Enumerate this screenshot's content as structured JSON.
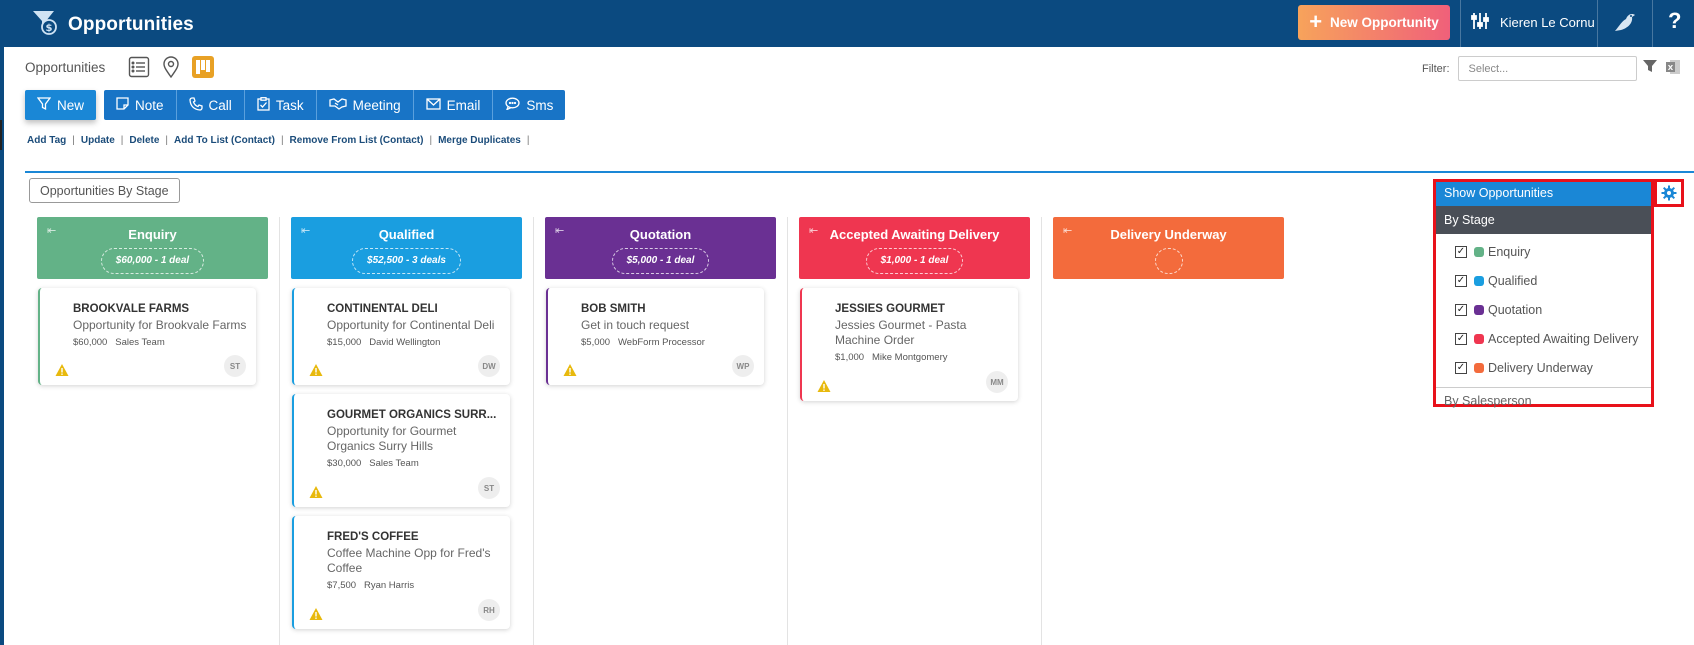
{
  "header": {
    "title": "Opportunities",
    "new_opportunity": "New Opportunity",
    "user_name": "Kieren Le Cornu",
    "help": "?"
  },
  "subheader": {
    "breadcrumb": "Opportunities",
    "filter_label": "Filter:",
    "filter_placeholder": "Select..."
  },
  "actions": {
    "new": "New",
    "note": "Note",
    "call": "Call",
    "task": "Task",
    "meeting": "Meeting",
    "email": "Email",
    "sms": "Sms"
  },
  "links": [
    "Add Tag",
    "Update",
    "Delete",
    "Add To List (Contact)",
    "Remove From List (Contact)",
    "Merge Duplicates"
  ],
  "view_label": "Opportunities By Stage",
  "colors": {
    "enquiry": "#63b287",
    "qualified": "#1a9ee0",
    "quotation": "#6a3093",
    "accepted": "#ef3650",
    "delivery": "#f36b3c"
  },
  "columns": [
    {
      "name": "Enquiry",
      "summary": "$60,000 - 1 deal",
      "cards": [
        {
          "name": "BROOKVALE FARMS",
          "desc": "Opportunity for Brookvale Farms",
          "amount": "$60,000",
          "owner": "Sales Team",
          "initials": "ST"
        }
      ]
    },
    {
      "name": "Qualified",
      "summary": "$52,500 - 3 deals",
      "cards": [
        {
          "name": "CONTINENTAL DELI",
          "desc": "Opportunity for Continental Deli",
          "amount": "$15,000",
          "owner": "David Wellington",
          "initials": "DW"
        },
        {
          "name": "GOURMET ORGANICS SURR...",
          "desc": "Opportunity for Gourmet Organics Surry Hills",
          "amount": "$30,000",
          "owner": "Sales Team",
          "initials": "ST"
        },
        {
          "name": "FRED'S COFFEE",
          "desc": "Coffee Machine Opp for Fred's Coffee",
          "amount": "$7,500",
          "owner": "Ryan Harris",
          "initials": "RH"
        }
      ]
    },
    {
      "name": "Quotation",
      "summary": "$5,000 - 1 deal",
      "cards": [
        {
          "name": "BOB SMITH",
          "desc": "Get in touch request",
          "amount": "$5,000",
          "owner": "WebForm Processor",
          "initials": "WP"
        }
      ]
    },
    {
      "name": "Accepted Awaiting Delivery",
      "summary": "$1,000 - 1 deal",
      "cards": [
        {
          "name": "JESSIES GOURMET",
          "desc": "Jessies Gourmet - Pasta Machine Order",
          "amount": "$1,000",
          "owner": "Mike Montgomery",
          "initials": "MM"
        }
      ]
    },
    {
      "name": "Delivery Underway",
      "summary": "",
      "cards": []
    }
  ],
  "panel": {
    "title": "Show Opportunities",
    "by_stage": "By Stage",
    "stages": [
      "Enquiry",
      "Qualified",
      "Quotation",
      "Accepted Awaiting Delivery",
      "Delivery Underway"
    ],
    "by_salesperson": "By Salesperson"
  }
}
